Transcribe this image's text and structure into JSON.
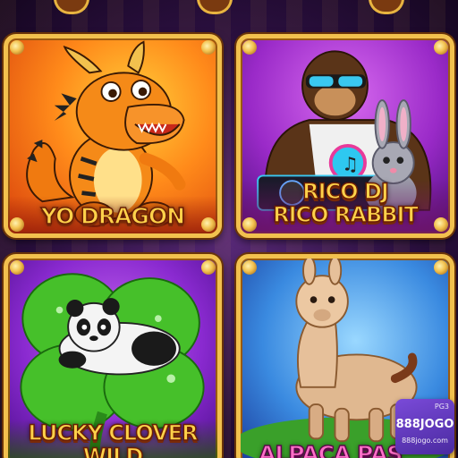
{
  "games": [
    {
      "title_lines": [
        "YO DRAGON"
      ]
    },
    {
      "title_lines": [
        "RICO DJ",
        "RICO RABBIT"
      ]
    },
    {
      "title_lines": [
        "LUCKY CLOVER",
        "WILD"
      ]
    },
    {
      "title_lines": [
        "ALPACA PAS"
      ]
    }
  ],
  "watermark": {
    "provider": "PG3",
    "brand": "888JOGO",
    "url": "888jogo.com"
  },
  "colors": {
    "frame_gold": "#f2c14e",
    "title_gold": "#ffd24a",
    "title_pink": "#ff6fc8",
    "watermark_purple": "#6a3ac8"
  },
  "icons": [
    "dragon-art",
    "gorilla-dj-art",
    "rabbit-art",
    "clover-art",
    "panda-art",
    "alpaca-art"
  ]
}
